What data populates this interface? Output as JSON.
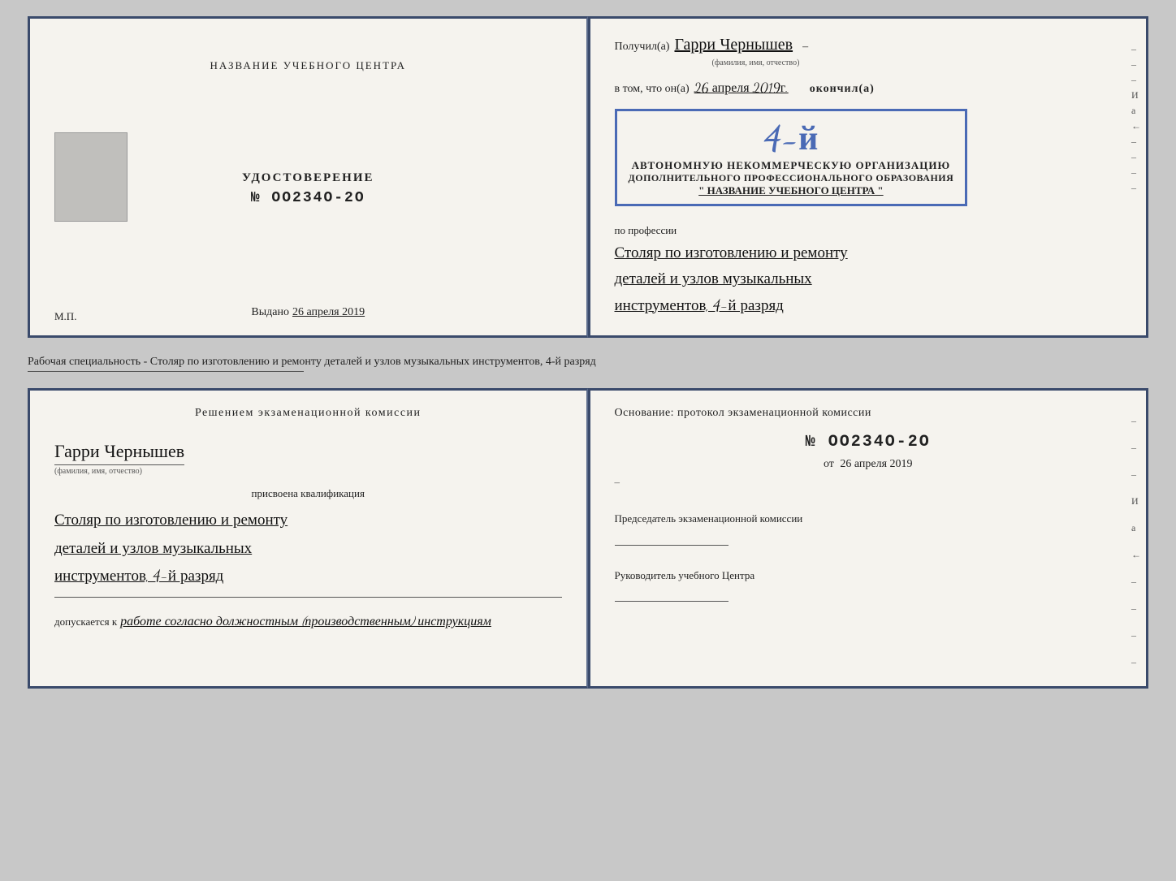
{
  "colors": {
    "background": "#c8c8c8",
    "page": "#f5f3ee",
    "border": "#3a4a6b",
    "stamp": "#4a6ab5",
    "text": "#222222",
    "handwritten": "#111111"
  },
  "top_section": {
    "left": {
      "training_center_label": "НАЗВАНИЕ УЧЕБНОГО ЦЕНТРА",
      "certificate_label": "УДОСТОВЕРЕНИЕ",
      "certificate_number": "№ OO234O-2O",
      "issued_label": "Выдано",
      "issued_date": "26 апреля 2019",
      "mp_label": "М.П."
    },
    "right": {
      "received_prefix": "Получил(а)",
      "recipient_name": "Гарри Чернышев",
      "recipient_sub": "(фамилия, имя, отчество)",
      "vtom_prefix": "в том, что он(а)",
      "completion_date": "26 апреля 2019г.",
      "finished_label": "окончил(а)",
      "stamp_line1": "АВТОНОМНУЮ НЕКОММЕРЧЕСКУЮ ОРГАНИЗАЦИЮ",
      "stamp_line2": "ДОПОЛНИТЕЛЬНОГО ПРОФЕССИОНАЛЬНОГО ОБРАЗОВАНИЯ",
      "stamp_line3": "\" НАЗВАНИЕ УЧЕБНОГО ЦЕНТРА \"",
      "stamp_fourth": "4-й",
      "profession_label": "по профессии",
      "profession_line1": "Столяр по изготовлению и ремонту",
      "profession_line2": "деталей и узлов музыкальных",
      "profession_line3": "инструментов, 4-й разряд"
    }
  },
  "separator": {
    "text": "Рабочая специальность - Столяр по изготовлению и ремонту деталей и узлов музыкальных инструментов, 4-й разряд"
  },
  "bottom_section": {
    "left": {
      "decision_title": "Решением  экзаменационной  комиссии",
      "person_name": "Гарри Чернышев",
      "fio_sub": "(фамилия, имя, отчество)",
      "assigned_label": "присвоена квалификация",
      "qualification_line1": "Столяр по изготовлению и ремонту",
      "qualification_line2": "деталей и узлов музыкальных",
      "qualification_line3": "инструментов, 4-й разряд",
      "допускается_prefix": "допускается к",
      "допускается_text": "работе согласно должностным (производственным) инструкциям"
    },
    "right": {
      "osnov_label": "Основание: протокол экзаменационной  комиссии",
      "protocol_number": "№  OO234O-2O",
      "ot_prefix": "от",
      "ot_date": "26 апреля 2019",
      "chairman_label": "Председатель экзаменационной комиссии",
      "head_label": "Руководитель учебного Центра"
    }
  },
  "edge_marks": {
    "marks": [
      "–",
      "–",
      "–",
      "И",
      "а",
      "←",
      "–",
      "–",
      "–",
      "–"
    ]
  }
}
